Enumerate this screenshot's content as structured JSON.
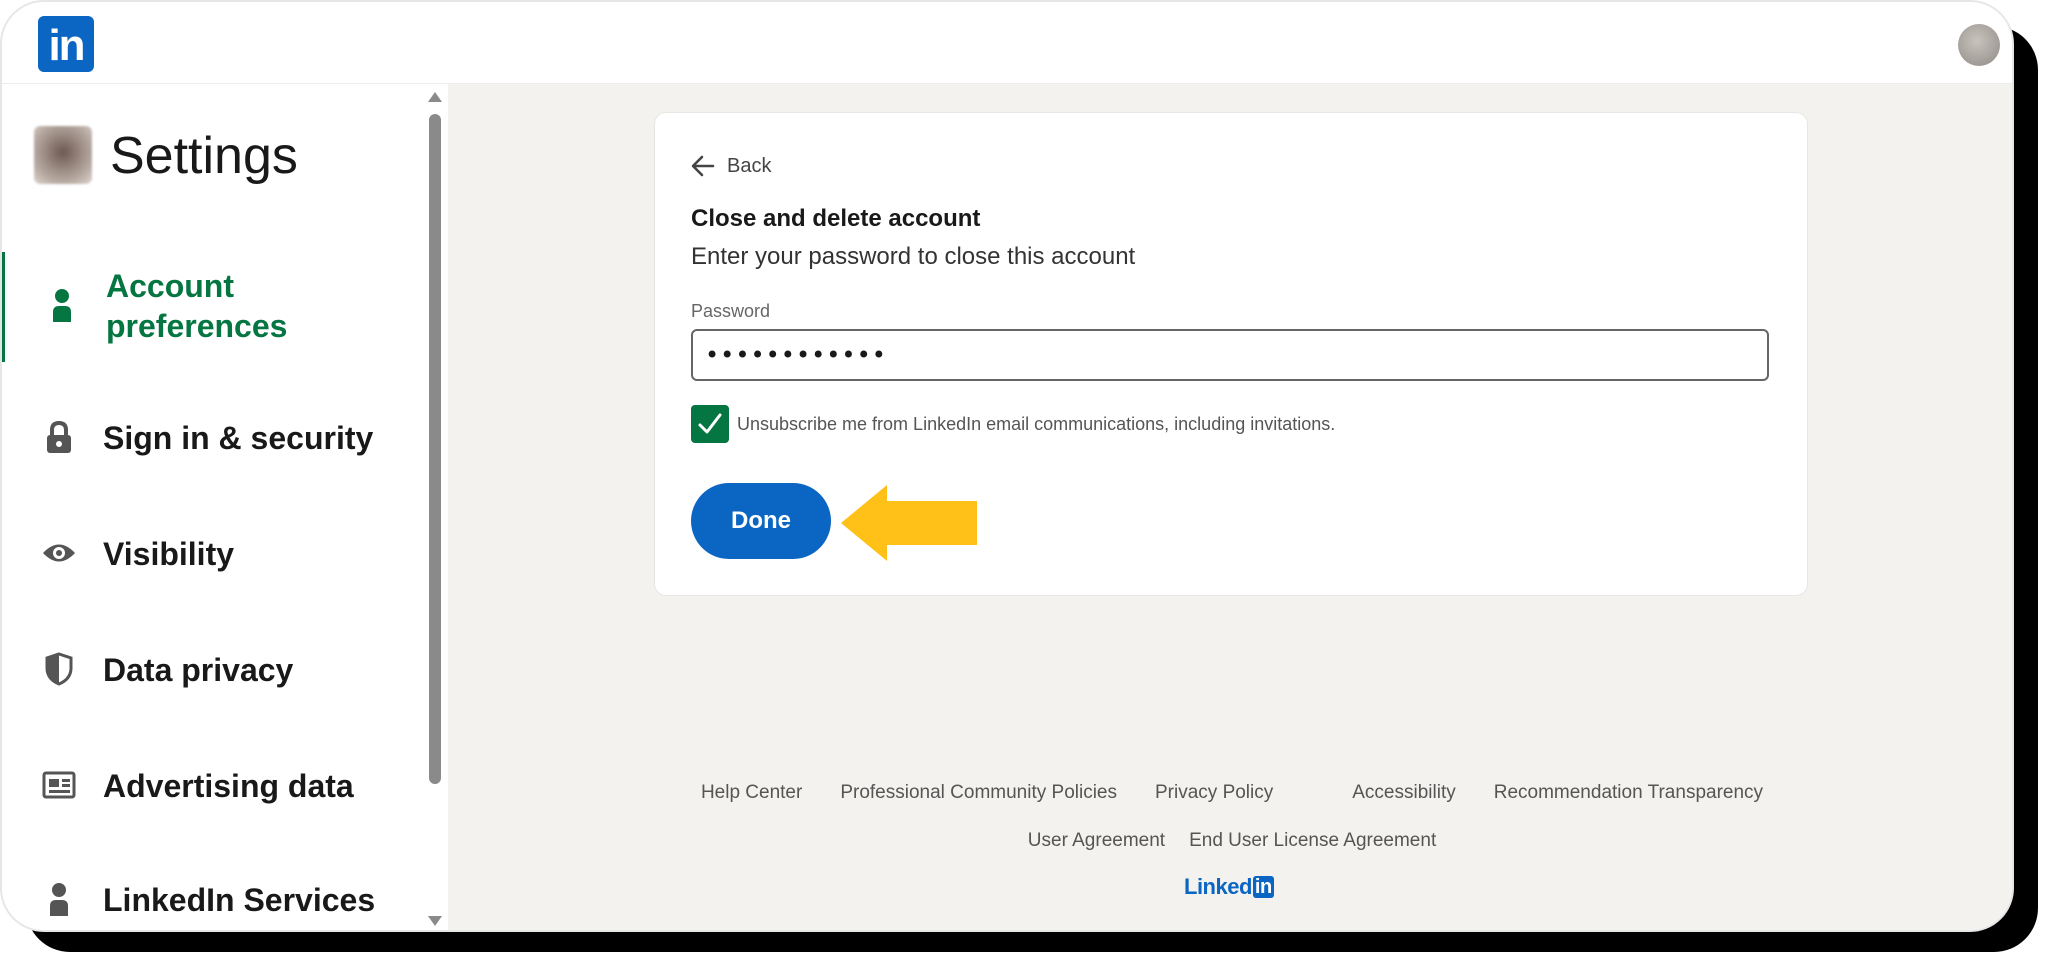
{
  "header": {
    "logo_text": "in"
  },
  "sidebar": {
    "title": "Settings",
    "items": [
      {
        "label": "Account preferences",
        "icon": "person-icon",
        "active": true
      },
      {
        "label": "Sign in & security",
        "icon": "lock-icon",
        "active": false
      },
      {
        "label": "Visibility",
        "icon": "eye-icon",
        "active": false
      },
      {
        "label": "Data privacy",
        "icon": "shield-icon",
        "active": false
      },
      {
        "label": "Advertising data",
        "icon": "newspaper-icon",
        "active": false
      },
      {
        "label": "LinkedIn Services",
        "icon": "person-icon",
        "active": false
      }
    ]
  },
  "card": {
    "back_label": "Back",
    "title": "Close and delete account",
    "subtitle": "Enter your password to close this account",
    "password_label": "Password",
    "password_value": "••••••••••••",
    "checkbox_label": "Unsubscribe me from LinkedIn email communications, including invitations.",
    "checkbox_checked": true,
    "done_label": "Done"
  },
  "footer": {
    "row1": [
      "Help Center",
      "Professional Community Policies",
      "Privacy Policy",
      "Accessibility",
      "Recommendation Transparency"
    ],
    "row2": [
      "User Agreement",
      "End User License Agreement"
    ],
    "logo_word": "Linked",
    "logo_box": "in"
  },
  "colors": {
    "brand": "#0a66c2",
    "active_green": "#057642",
    "annotation_arrow": "#ffc018"
  }
}
